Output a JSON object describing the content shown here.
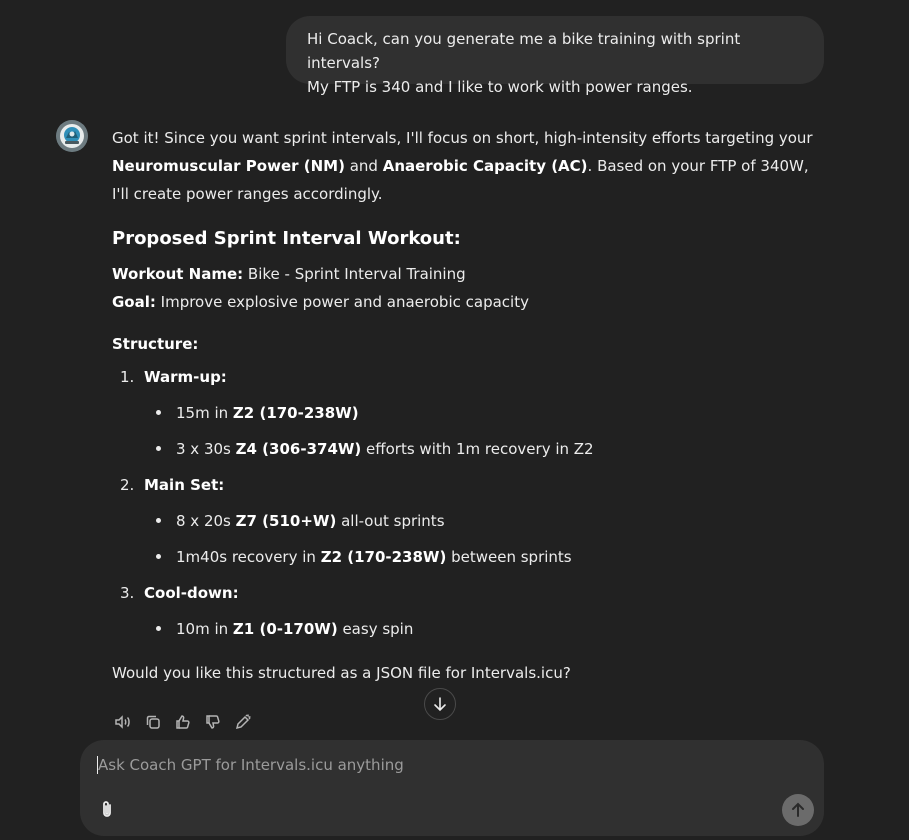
{
  "user_message": {
    "line1": "Hi Coack, can you generate me a bike training with sprint intervals?",
    "line2": "My FTP is 340 and I like to work with power ranges."
  },
  "assistant": {
    "avatar_icon": "coach-gpt-logo",
    "intro": {
      "t1": "Got it! Since you want sprint intervals, I'll focus on short, high-intensity efforts targeting your ",
      "b1": "Neuromuscular Power (NM)",
      "t2": " and ",
      "b2": "Anaerobic Capacity (AC)",
      "t3": ". Based on your FTP of 340W, I'll create power ranges accordingly."
    },
    "heading": "Proposed Sprint Interval Workout:",
    "workout_name_label": "Workout Name:",
    "workout_name": " Bike - Sprint Interval Training",
    "goal_label": "Goal:",
    "goal": " Improve explosive power and anaerobic capacity",
    "structure_label": "Structure:",
    "sections": [
      {
        "num": "1.",
        "title": "Warm-up:",
        "items": [
          {
            "pre": "15m in ",
            "bold": "Z2 (170-238W)",
            "post": ""
          },
          {
            "pre": "3 x 30s ",
            "bold": "Z4 (306-374W)",
            "post": " efforts with 1m recovery in Z2"
          }
        ]
      },
      {
        "num": "2.",
        "title": "Main Set:",
        "items": [
          {
            "pre": "8 x 20s ",
            "bold": "Z7 (510+W)",
            "post": " all-out sprints"
          },
          {
            "pre": "1m40s recovery in ",
            "bold": "Z2 (170-238W)",
            "post": " between sprints"
          }
        ]
      },
      {
        "num": "3.",
        "title": "Cool-down:",
        "items": [
          {
            "pre": "10m in ",
            "bold": "Z1 (0-170W)",
            "post": " easy spin"
          }
        ]
      }
    ],
    "closing": "Would you like this structured as a JSON file for Intervals.icu?"
  },
  "action_icons": [
    "read-aloud-icon",
    "copy-icon",
    "thumbs-up-icon",
    "thumbs-down-icon",
    "edit-icon"
  ],
  "composer": {
    "placeholder": "Ask Coach GPT for Intervals.icu anything",
    "attach_icon": "paperclip-icon",
    "send_icon": "arrow-up-icon"
  },
  "colors": {
    "background": "#212121",
    "bubble": "#303030",
    "text": "#ececec",
    "muted": "#9b9b9b"
  }
}
